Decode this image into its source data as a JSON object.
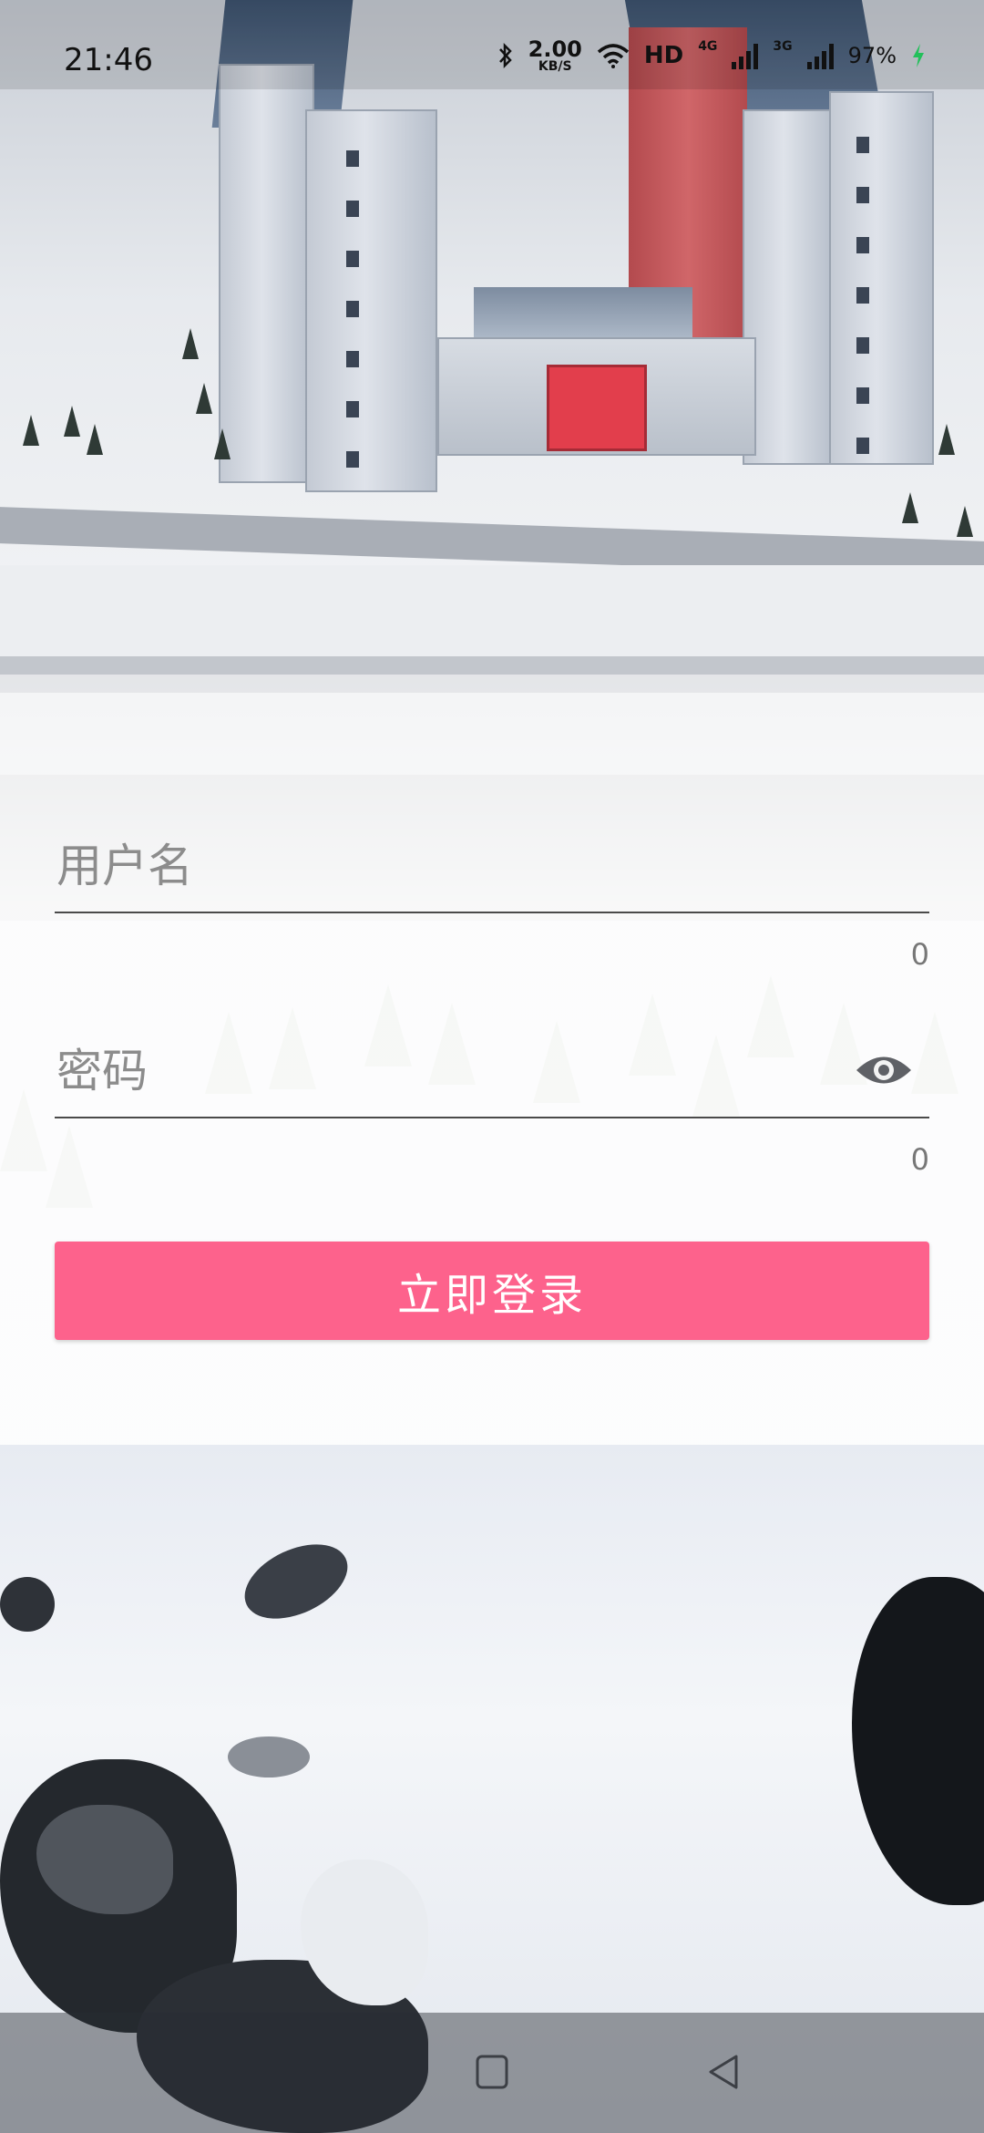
{
  "status_bar": {
    "time": "21:46",
    "net_speed_value": "2.00",
    "net_speed_unit": "KB/S",
    "hd_label": "HD",
    "net_1": "4G",
    "net_2": "3G",
    "battery": "97%"
  },
  "login": {
    "username_placeholder": "用户名",
    "username_counter": "0",
    "password_placeholder": "密码",
    "password_counter": "0",
    "submit_label": "立即登录"
  },
  "colors": {
    "accent": "#fd628c"
  },
  "icons": {
    "bluetooth": "bluetooth-icon",
    "wifi": "wifi-icon",
    "signal": "signal-icon",
    "charging": "charging-icon",
    "eye": "visibility-icon",
    "home": "home-icon",
    "back": "back-icon"
  }
}
